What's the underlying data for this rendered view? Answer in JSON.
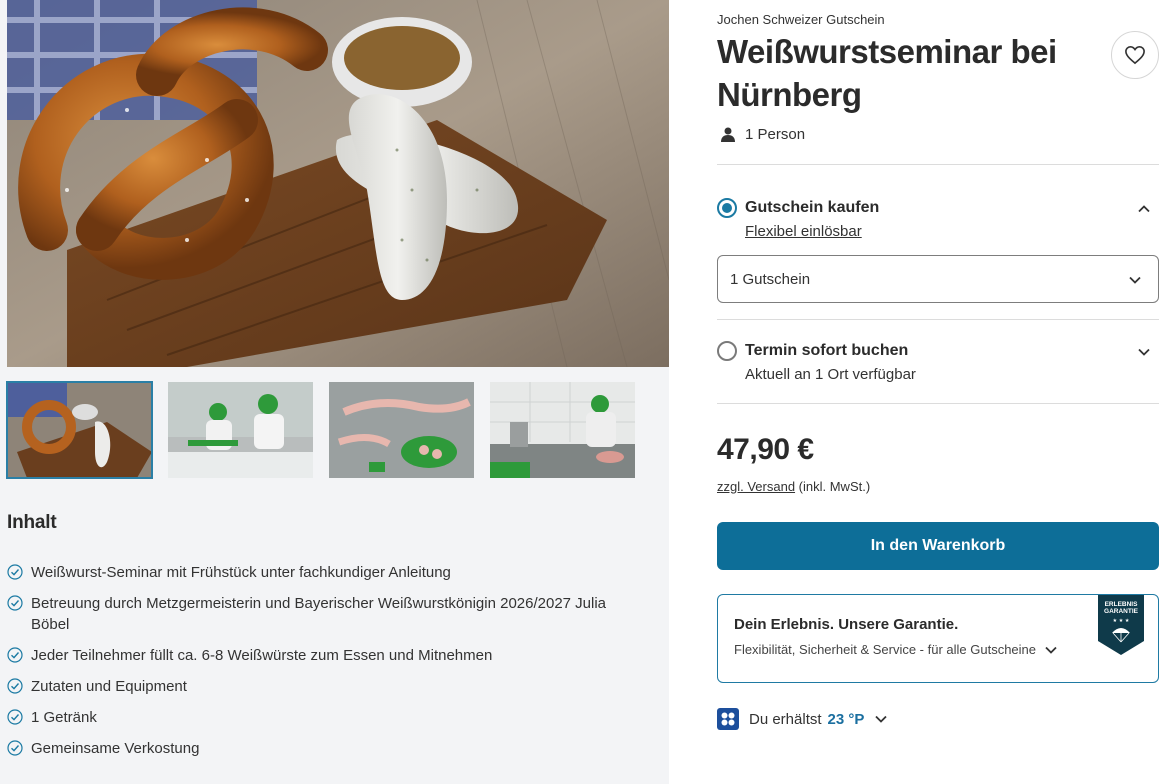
{
  "gallery": {
    "hero_alt": "Brezel und Weißwürste auf Holzbrett",
    "thumbnails": [
      "Brezel und Weißwürste",
      "Metzger am Arbeitstisch",
      "Weißwürste auf Tisch",
      "Metzgerei Werkstatt"
    ]
  },
  "content": {
    "heading": "Inhalt",
    "items": [
      "Weißwurst-Seminar mit Frühstück unter fachkundiger Anleitung",
      "Betreuung durch Metzgermeisterin und Bayerischer Weißwurstkönigin 2026/2027 Julia Böbel",
      "Jeder Teilnehmer füllt ca. 6-8 Weißwürste zum Essen und Mitnehmen",
      "Zutaten und Equipment",
      "1 Getränk",
      "Gemeinsame Verkostung"
    ]
  },
  "product": {
    "brand": "Jochen Schweizer Gutschein",
    "title": "Weißwurstseminar bei Nürnberg",
    "persons": "1 Person"
  },
  "options": {
    "voucher": {
      "title": "Gutschein kaufen",
      "subtitle": "Flexibel einlösbar",
      "selected": true
    },
    "quantity": "1 Gutschein",
    "booking": {
      "title": "Termin sofort buchen",
      "subtitle": "Aktuell an 1 Ort verfügbar",
      "selected": false
    }
  },
  "pricing": {
    "price": "47,90 €",
    "shipping_link": "zzgl. Versand",
    "tax_note": "(inkl. MwSt.)"
  },
  "cart": {
    "label": "In den Warenkorb"
  },
  "guarantee": {
    "title": "Dein Erlebnis. Unsere Garantie.",
    "subtitle": "Flexibilität, Sicherheit & Service - für alle Gutscheine",
    "badge_line1": "ERLEBNIS",
    "badge_line2": "GARANTIE"
  },
  "points": {
    "prefix": "Du erhältst",
    "value": "23 °P"
  },
  "colors": {
    "accent": "#0d6e98",
    "radio": "#1b7aa3",
    "points": "#1b6fa0",
    "badge": "#0f3a4a"
  }
}
